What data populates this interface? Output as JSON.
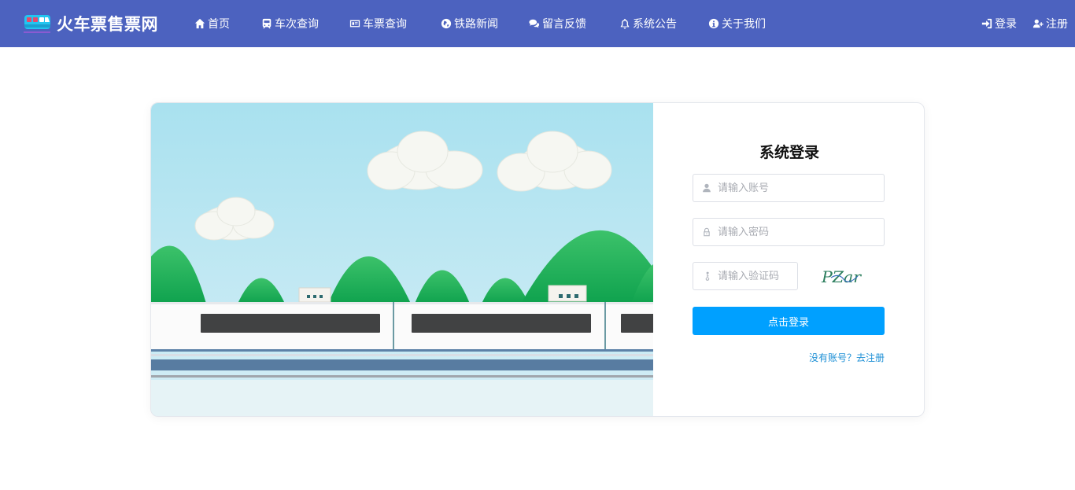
{
  "app": {
    "title": "火车票售票网"
  },
  "nav": {
    "items": [
      {
        "label": "首页",
        "icon": "home-icon"
      },
      {
        "label": "车次查询",
        "icon": "train-icon"
      },
      {
        "label": "车票查询",
        "icon": "ticket-icon"
      },
      {
        "label": "铁路新闻",
        "icon": "globe-icon"
      },
      {
        "label": "留言反馈",
        "icon": "comments-icon"
      },
      {
        "label": "系统公告",
        "icon": "bell-icon"
      },
      {
        "label": "关于我们",
        "icon": "info-icon"
      }
    ],
    "login": {
      "label": "登录",
      "icon": "sign-in-icon"
    },
    "register": {
      "label": "注册",
      "icon": "user-plus-icon"
    }
  },
  "login_form": {
    "title": "系统登录",
    "username": {
      "placeholder": "请输入账号",
      "value": ""
    },
    "password": {
      "placeholder": "请输入密码",
      "value": ""
    },
    "captcha": {
      "placeholder": "请输入验证码",
      "value": "",
      "image_text": "PZar"
    },
    "submit_label": "点击登录",
    "register_prompt": "没有账号？去注册"
  },
  "colors": {
    "navbar": "#4c62bf",
    "primary_button": "#00a0ff",
    "link": "#1e90d6"
  }
}
